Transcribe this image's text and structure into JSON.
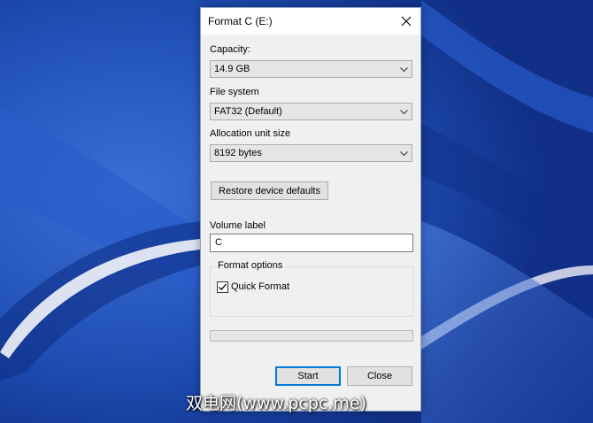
{
  "dialog": {
    "title": "Format C (E:)",
    "capacity": {
      "label": "Capacity:",
      "value": "14.9 GB"
    },
    "file_system": {
      "label": "File system",
      "value": "FAT32 (Default)"
    },
    "allocation": {
      "label": "Allocation unit size",
      "value": "8192 bytes"
    },
    "restore_label": "Restore device defaults",
    "volume_label": {
      "label": "Volume label",
      "value": "C"
    },
    "format_options": {
      "title": "Format options",
      "quick_format_label": "Quick Format",
      "quick_format_checked": true
    },
    "progress": 0,
    "start_label": "Start",
    "close_label": "Close"
  },
  "watermark": "双电网(www.pcpc.me)",
  "colors": {
    "desktop": "#1f52b8",
    "dialog_bg": "#f0f0f0",
    "default_button_border": "#0078d7"
  },
  "icons": [
    "close-icon",
    "chevron-down-icon",
    "checkmark-icon"
  ]
}
